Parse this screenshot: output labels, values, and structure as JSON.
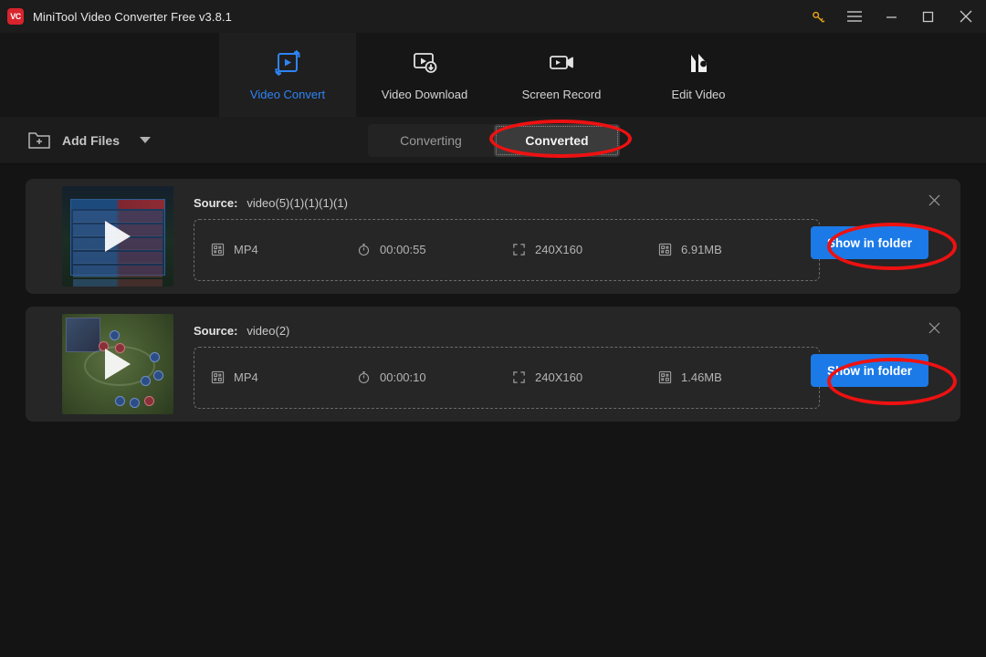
{
  "window": {
    "app_title": "MiniTool Video Converter Free v3.8.1",
    "logo_text": "VC",
    "controls": [
      {
        "name": "key-icon",
        "glyph": "key"
      },
      {
        "name": "menu-icon",
        "glyph": "hamburger"
      },
      {
        "name": "minimize-icon",
        "glyph": "minimize"
      },
      {
        "name": "maximize-icon",
        "glyph": "maximize"
      },
      {
        "name": "close-icon",
        "glyph": "close"
      }
    ]
  },
  "nav": {
    "items": [
      {
        "label": "Video Convert",
        "icon": "video-convert-icon",
        "active": true
      },
      {
        "label": "Video Download",
        "icon": "video-download-icon",
        "active": false
      },
      {
        "label": "Screen Record",
        "icon": "screen-record-icon",
        "active": false
      },
      {
        "label": "Edit Video",
        "icon": "edit-video-icon",
        "active": false
      }
    ],
    "active_color": "#2f84f5"
  },
  "toolbar": {
    "add_files_label": "Add Files",
    "add_files_icon": "folder-plus-icon",
    "dropdown_icon": "caret-down-icon",
    "tabs": [
      {
        "label": "Converting",
        "active": false
      },
      {
        "label": "Converted",
        "active": true
      }
    ]
  },
  "files": [
    {
      "source_label": "Source:",
      "source_name": "video(5)(1)(1)(1)(1)",
      "format": "MP4",
      "duration": "00:00:55",
      "resolution": "240X160",
      "size": "6.91MB",
      "action_label": "Show in folder",
      "thumbnail": "game-scoreboard"
    },
    {
      "source_label": "Source:",
      "source_name": "video(2)",
      "format": "MP4",
      "duration": "00:00:10",
      "resolution": "240X160",
      "size": "1.46MB",
      "action_label": "Show in folder",
      "thumbnail": "game-map"
    }
  ],
  "annotations": {
    "color": "#ee1111",
    "targets": [
      "converted-tab",
      "show-in-folder-button-row-1",
      "show-in-folder-button-row-2"
    ]
  },
  "colors": {
    "accent_blue": "#1b7ae8",
    "nav_active_blue": "#2f84f5",
    "annotation_red": "#ee1111",
    "page_bg": "#141414",
    "card_bg": "#262626"
  }
}
